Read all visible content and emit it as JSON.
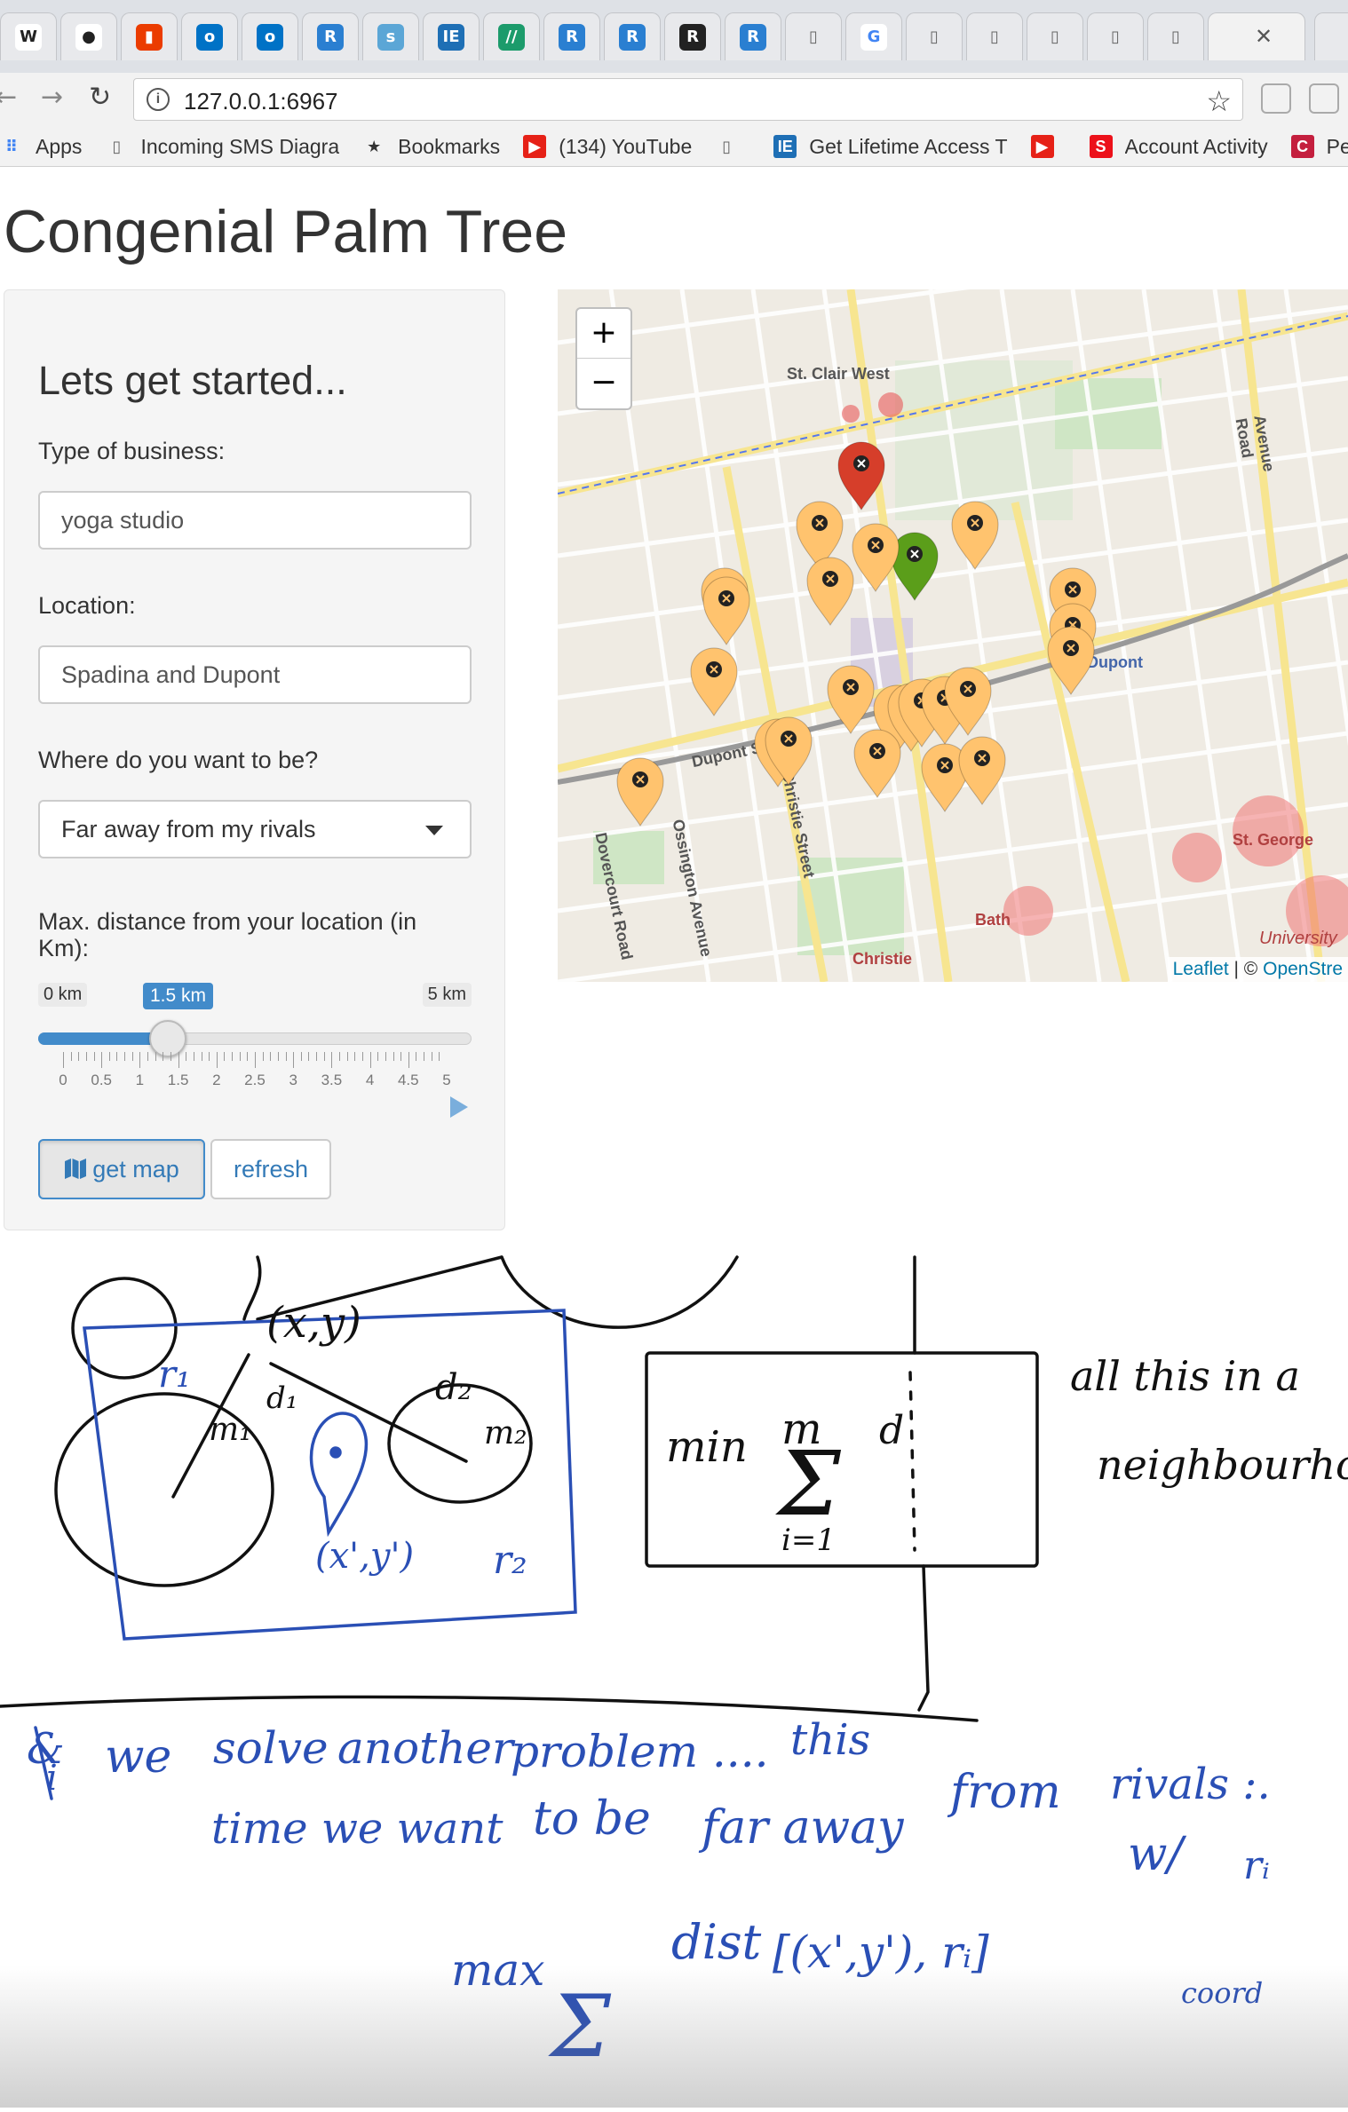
{
  "browser": {
    "url": "127.0.0.1:6967",
    "tabs": [
      {
        "icon": "wikipedia-icon",
        "glyph": "W",
        "color": "#222222",
        "bg": "#ffffff"
      },
      {
        "icon": "github-icon",
        "glyph": "●",
        "color": "#222222",
        "bg": "#ffffff"
      },
      {
        "icon": "office-icon",
        "glyph": "▮",
        "color": "#ffffff",
        "bg": "#eb3c00"
      },
      {
        "icon": "outlook-icon",
        "glyph": "o",
        "color": "#ffffff",
        "bg": "#0072c6"
      },
      {
        "icon": "outlook-icon",
        "glyph": "o",
        "color": "#ffffff",
        "bg": "#0072c6"
      },
      {
        "icon": "r-icon",
        "glyph": "R",
        "color": "#ffffff",
        "bg": "#2a7fd1"
      },
      {
        "icon": "shiny-icon",
        "glyph": "s",
        "color": "#ffffff",
        "bg": "#5ba6d6"
      },
      {
        "icon": "ie-icon",
        "glyph": "IE",
        "color": "#ffffff",
        "bg": "#1e6fb5"
      },
      {
        "icon": "overleaf-icon",
        "glyph": "//",
        "color": "#ffffff",
        "bg": "#1c9b6b"
      },
      {
        "icon": "r-icon",
        "glyph": "R",
        "color": "#ffffff",
        "bg": "#2a7fd1"
      },
      {
        "icon": "r-icon",
        "glyph": "R",
        "color": "#ffffff",
        "bg": "#2a7fd1"
      },
      {
        "icon": "r-dark-icon",
        "glyph": "R",
        "color": "#ffffff",
        "bg": "#222222"
      },
      {
        "icon": "r-icon",
        "glyph": "R",
        "color": "#ffffff",
        "bg": "#2a7fd1"
      },
      {
        "icon": "document-icon",
        "glyph": "▯",
        "color": "#666666",
        "bg": "transparent"
      },
      {
        "icon": "google-icon",
        "glyph": "G",
        "color": "#4285f4",
        "bg": "#ffffff"
      },
      {
        "icon": "document-icon",
        "glyph": "▯",
        "color": "#666666",
        "bg": "transparent"
      },
      {
        "icon": "document-icon",
        "glyph": "▯",
        "color": "#666666",
        "bg": "transparent"
      },
      {
        "icon": "document-icon",
        "glyph": "▯",
        "color": "#666666",
        "bg": "transparent"
      },
      {
        "icon": "document-icon",
        "glyph": "▯",
        "color": "#666666",
        "bg": "transparent"
      },
      {
        "icon": "document-icon",
        "glyph": "▯",
        "color": "#666666",
        "bg": "transparent"
      }
    ],
    "bookmarks": [
      {
        "icon": "apps-grid-icon",
        "label": "Apps",
        "color": "#4285f4"
      },
      {
        "icon": "document-icon",
        "label": "Incoming SMS Diagra",
        "color": "#666666"
      },
      {
        "icon": "star-icon",
        "label": "Bookmarks",
        "color": "#333333"
      },
      {
        "icon": "youtube-icon",
        "label": "(134) YouTube",
        "color": "#e62117"
      },
      {
        "icon": "document-icon",
        "label": "",
        "color": "#666666"
      },
      {
        "icon": "ie-icon",
        "label": "Get Lifetime Access T",
        "color": "#1e6fb5"
      },
      {
        "icon": "youtube-icon",
        "label": "",
        "color": "#e62117"
      },
      {
        "icon": "scotiabank-icon",
        "label": "Account Activity",
        "color": "#ec111a"
      },
      {
        "icon": "cibc-icon",
        "label": "Pe",
        "color": "#c41f3e"
      }
    ]
  },
  "app": {
    "title": "Congenial Palm Tree",
    "panel_heading": "Lets get started...",
    "business_label": "Type of business:",
    "business_value": "yoga studio",
    "location_label": "Location:",
    "location_value": "Spadina and Dupont",
    "where_label": "Where do you want to be?",
    "where_value": "Far away from my rivals",
    "distance_label": "Max. distance from your location (in Km):",
    "slider": {
      "min_label": "0 km",
      "max_label": "5 km",
      "current_label": "1.5 km",
      "min": 0,
      "max": 5,
      "value": 1.5,
      "ticks": [
        "0",
        "0.5",
        "1",
        "1.5",
        "2",
        "2.5",
        "3",
        "3.5",
        "4",
        "4.5",
        "5"
      ]
    },
    "get_map_label": "get map",
    "refresh_label": "refresh"
  },
  "map": {
    "zoom_in": "+",
    "zoom_out": "−",
    "attribution_link": "Leaflet",
    "attribution_sep": " | © ",
    "attribution_osm": "OpenStre",
    "labels": [
      "St. Clair West",
      "Dupont",
      "St. George",
      "Bath",
      "Christie",
      "University",
      "Dupont Street",
      "Christie Street",
      "Ossington Avenue",
      "Dovercourt Road",
      "Avenue Road"
    ],
    "colors": {
      "rival": "#ffc36e",
      "target": "#d63e2a",
      "location": "#5b9e1a"
    }
  },
  "sketch": {
    "black_texts": [
      "(x,y)",
      "d₁",
      "d₂",
      "m₁",
      "m₂",
      "min",
      "m",
      "d",
      "i=1",
      "all this in a",
      "neighbourhood"
    ],
    "blue_texts": [
      "r₁",
      "(x',y')",
      "r₂",
      "i",
      "&",
      "we",
      "solve",
      "another",
      "problem ....",
      "this",
      "time we want",
      "to be",
      "far away",
      "from",
      "rivals :.",
      "max",
      "dist",
      "[(x',y'), rᵢ]",
      "w/",
      "rᵢ",
      "coord"
    ],
    "colors": {
      "ink_black": "#111111",
      "ink_blue": "#2a4fb5"
    }
  }
}
